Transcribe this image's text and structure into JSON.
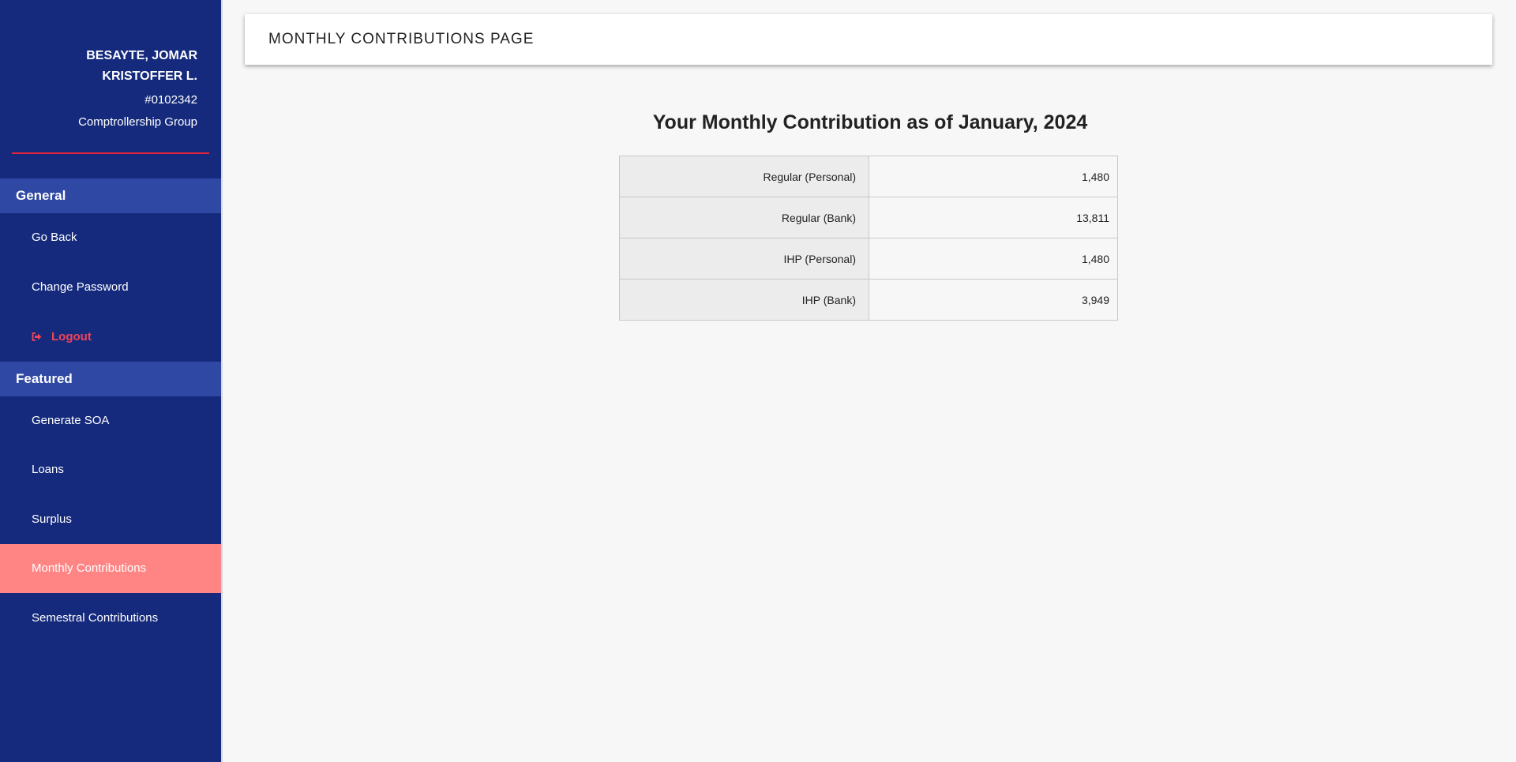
{
  "profile": {
    "name_line1": "BESAYTE, JOMAR",
    "name_line2": "KRISTOFFER L.",
    "id": "#0102342",
    "group": "Comptrollership Group"
  },
  "sidebar": {
    "general": {
      "header": "General",
      "items": [
        {
          "label": "Go Back"
        },
        {
          "label": "Change Password"
        },
        {
          "label": "Logout",
          "icon": "sign-out-icon"
        }
      ]
    },
    "featured": {
      "header": "Featured",
      "items": [
        {
          "label": "Generate SOA"
        },
        {
          "label": "Loans"
        },
        {
          "label": "Surplus"
        },
        {
          "label": "Monthly Contributions",
          "active": true
        },
        {
          "label": "Semestral Contributions"
        }
      ]
    }
  },
  "topbar": {
    "title": "MONTHLY CONTRIBUTIONS PAGE"
  },
  "main": {
    "heading": "Your Monthly Contribution as of January, 2024",
    "rows": [
      {
        "label": "Regular (Personal)",
        "value": "1,480"
      },
      {
        "label": "Regular (Bank)",
        "value": "13,811"
      },
      {
        "label": "IHP (Personal)",
        "value": "1,480"
      },
      {
        "label": "IHP (Bank)",
        "value": "3,949"
      }
    ]
  },
  "colors": {
    "sidebar_bg": "#152a7c",
    "section_header_bg": "#2e48a3",
    "active_item_bg": "#ff8585",
    "accent_red": "#e4243b",
    "logout_text": "#f0445a"
  }
}
